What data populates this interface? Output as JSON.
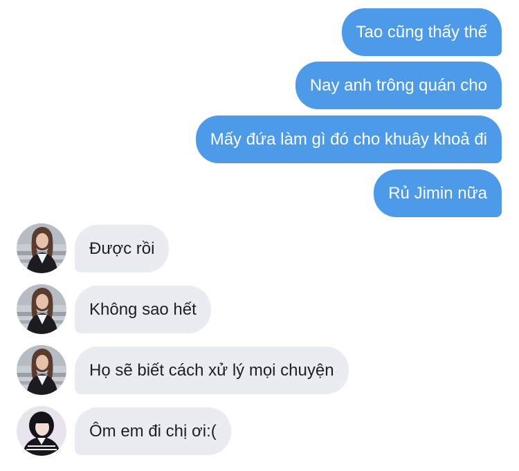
{
  "messages": [
    {
      "side": "outgoing",
      "text": "Tao cũng thấy thế"
    },
    {
      "side": "outgoing",
      "text": "Nay anh trông quán cho"
    },
    {
      "side": "outgoing",
      "text": "Mấy đứa làm gì đó cho khuây khoả đi"
    },
    {
      "side": "outgoing",
      "text": "Rủ Jimin nữa"
    },
    {
      "side": "incoming",
      "text": "Được rồi",
      "avatar": "avatar-photo-1"
    },
    {
      "side": "incoming",
      "text": "Không sao hết",
      "avatar": "avatar-photo-1"
    },
    {
      "side": "incoming",
      "text": "Họ sẽ biết cách xử lý mọi chuyện",
      "avatar": "avatar-photo-1"
    },
    {
      "side": "incoming",
      "text": "Ôm em đi chị ơi:(",
      "avatar": "avatar-photo-2"
    }
  ],
  "colors": {
    "outgoing_bubble": "#4c9ae8",
    "outgoing_text": "#ffffff",
    "incoming_bubble": "#e9ecf0",
    "incoming_text": "#1d1f22"
  }
}
